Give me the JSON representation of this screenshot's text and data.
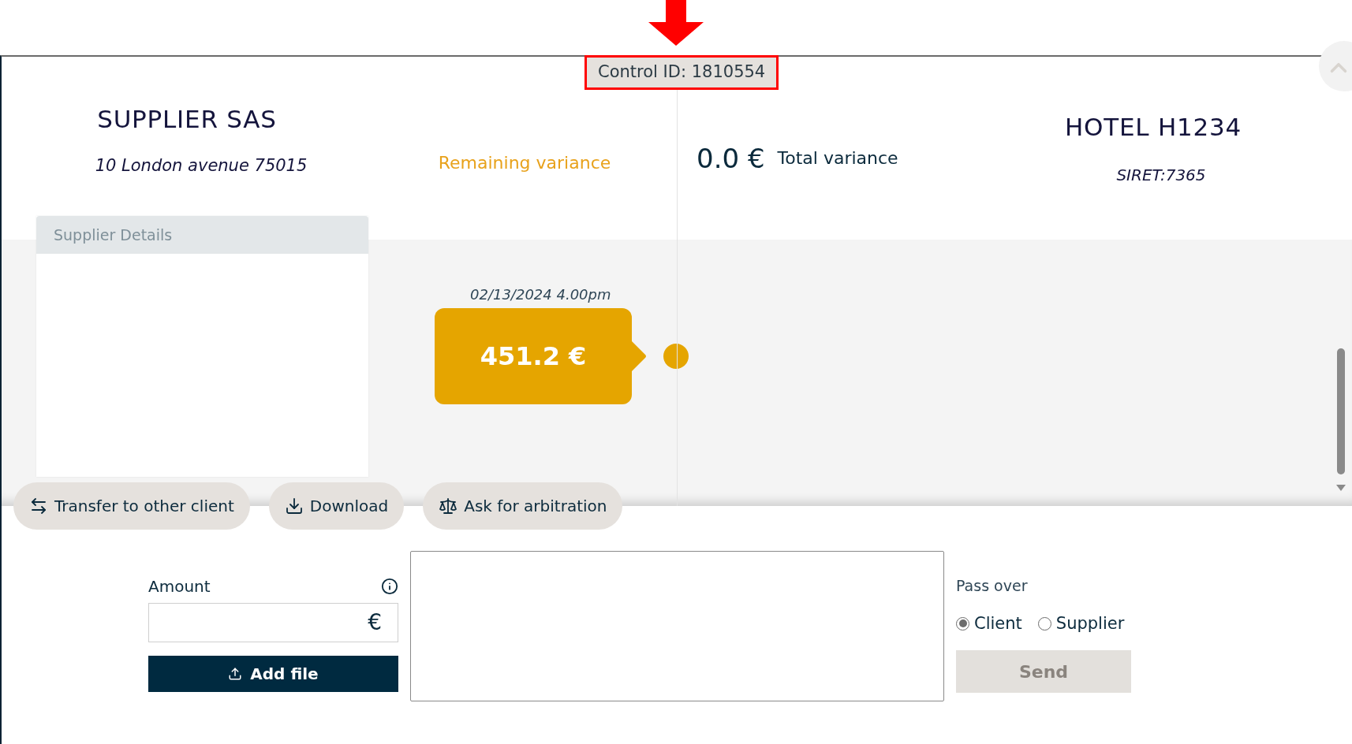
{
  "annotation": {
    "control_id": "Control ID: 1810554"
  },
  "supplier": {
    "name": "SUPPLIER SAS",
    "address": "10 London avenue 75015"
  },
  "remaining_variance": "Remaining variance",
  "total_variance": {
    "amount": "0.0 €",
    "label": "Total variance"
  },
  "client": {
    "name": "HOTEL H1234",
    "siret": "SIRET:7365"
  },
  "supplier_details": {
    "title": "Supplier Details"
  },
  "timeline": [
    {
      "date": "02/13/2024 4.00pm",
      "amount": "451.2 €"
    }
  ],
  "actions": [
    {
      "kind": "transfer",
      "label": "Transfer to other client"
    },
    {
      "kind": "download",
      "label": "Download"
    },
    {
      "kind": "arbitration",
      "label": "Ask for arbitration"
    }
  ],
  "form": {
    "amount_label": "Amount",
    "currency": "€",
    "add_file": "Add file",
    "pass_over": "Pass over",
    "options": [
      {
        "label": "Client",
        "selected": true
      },
      {
        "label": "Supplier",
        "selected": false
      }
    ],
    "send": {
      "label": "Send",
      "disabled": true
    }
  }
}
